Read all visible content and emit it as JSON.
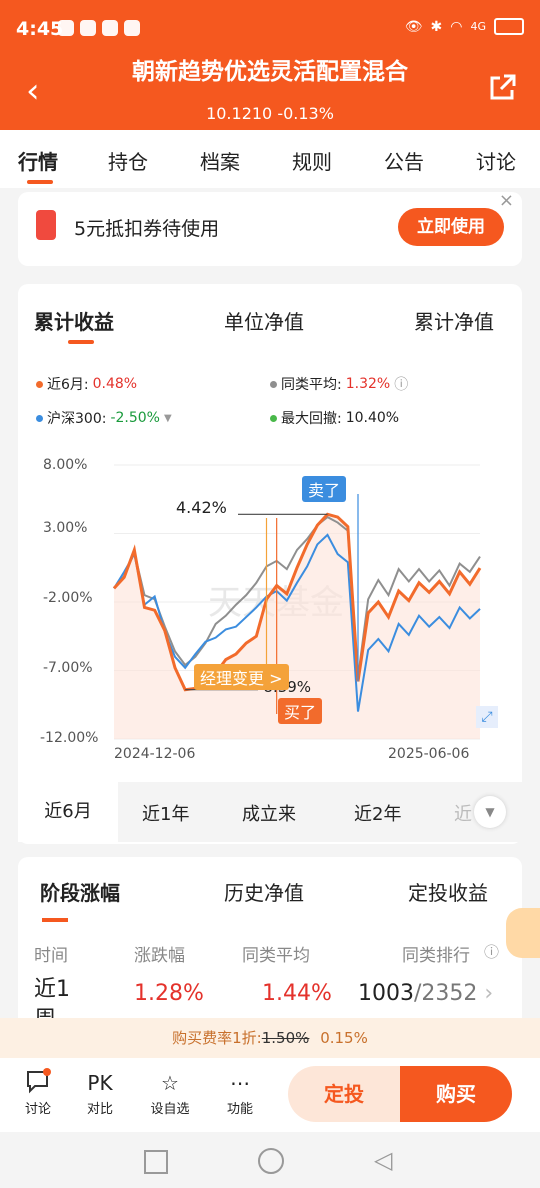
{
  "status": {
    "time": "4:45",
    "network": "4G",
    "battery_icon": "battery-icon"
  },
  "header": {
    "title": "朝新趋势优选灵活配置混合",
    "nav_value": "10.1210",
    "nav_change": "-0.13%"
  },
  "tabs": [
    "行情",
    "持仓",
    "档案",
    "规则",
    "公告",
    "讨论"
  ],
  "coupon": {
    "text": "5元抵扣券待使用",
    "button": "立即使用"
  },
  "chart_tabs": [
    "累计收益",
    "单位净值",
    "累计净值"
  ],
  "legend": {
    "fund_label": "近6月:",
    "fund_value": "0.48%",
    "avg_label": "同类平均:",
    "avg_value": "1.32%",
    "index_label": "沪深300:",
    "index_value": "-2.50%",
    "drawdown_label": "最大回撤:",
    "drawdown_value": "10.40%"
  },
  "chart_data": {
    "type": "line",
    "y_ticks": [
      "8.00%",
      "3.00%",
      "-2.00%",
      "-7.00%",
      "-12.00%"
    ],
    "x_ticks": [
      "2024-12-06",
      "2025-06-06"
    ],
    "ylim": [
      -12,
      8
    ],
    "series": [
      {
        "name": "近6月",
        "color": "#f26b2c",
        "values": [
          -1.0,
          -0.2,
          1.8,
          -2.4,
          -2.6,
          -4.1,
          -6.8,
          -8.4,
          -8.3,
          -7.8,
          -7.2,
          -6.2,
          -5.8,
          -5.0,
          -4.5,
          -1.8,
          -0.8,
          -1.4,
          0.5,
          2.2,
          3.6,
          4.4,
          4.2,
          3.5,
          -7.8,
          -2.8,
          -2.0,
          -3.1,
          -1.2,
          -1.9,
          -0.6,
          -1.3,
          -0.5,
          -1.4,
          0.2,
          -0.7,
          0.48
        ]
      },
      {
        "name": "同类平均",
        "color": "#8f8f8f",
        "values": [
          -1.0,
          -0.1,
          1.6,
          -1.5,
          -1.8,
          -3.8,
          -5.6,
          -6.6,
          -6.0,
          -5.0,
          -3.6,
          -3.0,
          -2.2,
          -1.5,
          -0.6,
          0.6,
          1.0,
          0.4,
          1.8,
          2.6,
          3.6,
          4.2,
          3.8,
          3.2,
          -7.5,
          -1.8,
          -0.4,
          -1.5,
          0.4,
          -0.5,
          0.4,
          -0.5,
          0.3,
          -0.8,
          0.8,
          0.2,
          1.32
        ]
      },
      {
        "name": "沪深300",
        "color": "#3b8ddf",
        "values": [
          -1.0,
          0.2,
          1.5,
          -2.2,
          -1.6,
          -4.2,
          -6.0,
          -6.8,
          -5.8,
          -4.9,
          -4.6,
          -4.0,
          -3.8,
          -3.1,
          -2.4,
          -1.6,
          -1.2,
          -1.9,
          -0.6,
          0.6,
          2.2,
          2.9,
          1.5,
          0.9,
          -10.0,
          -5.5,
          -4.7,
          -5.6,
          -3.6,
          -4.4,
          -3.0,
          -3.8,
          -3.1,
          -3.9,
          -2.4,
          -3.2,
          -2.5
        ]
      }
    ],
    "annotations": {
      "peak_label": "4.42%",
      "trough_label": "-8.39%",
      "sell_tag": "卖了",
      "buy_tag": "买了",
      "manager_tag": "经理变更 >"
    },
    "watermark": "天天基金"
  },
  "ranges": [
    "近6月",
    "近1年",
    "成立来",
    "近2年",
    "近"
  ],
  "stage": {
    "tabs": [
      "阶段涨幅",
      "历史净值",
      "定投收益"
    ],
    "headers": [
      "时间",
      "涨跌幅",
      "同类平均",
      "同类排行"
    ],
    "row": {
      "period": "近1周",
      "change": "1.28%",
      "avg": "1.44%",
      "rank": "1003",
      "total": "/2352"
    }
  },
  "fee": {
    "prefix": "购买费率1折:",
    "old": "1.50%",
    "new": "0.15%"
  },
  "bottom": {
    "items": [
      {
        "label": "讨论",
        "icon": "chat-icon"
      },
      {
        "label": "对比",
        "icon": "pk-icon",
        "text": "PK"
      },
      {
        "label": "设自选",
        "icon": "star-add-icon"
      },
      {
        "label": "功能",
        "icon": "more-icon"
      }
    ],
    "dingtou": "定投",
    "buy": "购买"
  }
}
